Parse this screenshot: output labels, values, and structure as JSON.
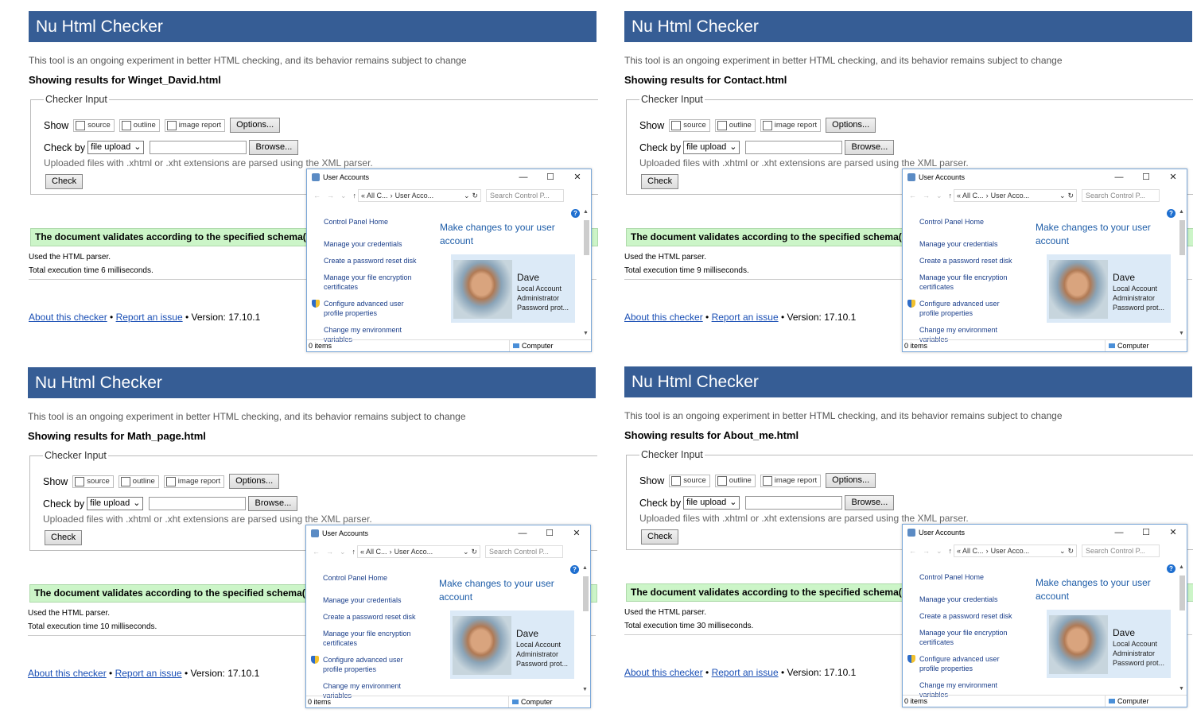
{
  "common": {
    "header_title": "Nu Html Checker",
    "tagline": "This tool is an ongoing experiment in better HTML checking, and its behavior remains subject to change",
    "showing_prefix": "Showing results for ",
    "checker_input_legend": "Checker Input",
    "show_label": "Show",
    "cb_source": "source",
    "cb_outline": "outline",
    "cb_image_report": "image report",
    "options_button": "Options...",
    "check_by_label": "Check by",
    "check_by_value": "file upload",
    "browse_button": "Browse...",
    "upload_note": "Uploaded files with .xhtml or .xht extensions are parsed using the XML parser.",
    "check_button": "Check",
    "valid_message": "The document validates according to the specified schema(s).",
    "used_parser": "Used the HTML parser.",
    "about_link": "About this checker",
    "bullet": " • ",
    "report_link": "Report an issue",
    "version": "Version: 17.10.1"
  },
  "panels": [
    {
      "file": "Winget_David.html",
      "exec": "Total execution time 6 milliseconds."
    },
    {
      "file": "Contact.html",
      "exec": "Total execution time 9 milliseconds."
    },
    {
      "file": "Math_page.html",
      "exec": "Total execution time 10 milliseconds."
    },
    {
      "file": "About_me.html",
      "exec": "Total execution time 30 milliseconds."
    }
  ],
  "window": {
    "title": "User Accounts",
    "minimize": "—",
    "maximize": "☐",
    "close": "✕",
    "nav_arrows": "←→⌄",
    "up_arrow": "↑",
    "breadcrumb_1": "« All C...",
    "breadcrumb_sep": "›",
    "breadcrumb_2": "User Acco...",
    "dropdown_chevron": "⌄",
    "refresh": "↻",
    "search_placeholder": "Search Control P...",
    "left_nav": [
      "Control Panel Home",
      "Manage your credentials",
      "Create a password reset disk",
      "Manage your file encryption certificates",
      "Configure advanced user profile properties",
      "Change my environment variables"
    ],
    "heading": "Make changes to your user account",
    "user_name": "Dave",
    "user_type": "Local Account",
    "user_role": "Administrator",
    "user_extra": "Password prot...",
    "help": "?",
    "scroll_up": "▲",
    "scroll_down": "▼",
    "status_items": "0 items",
    "status_location": "Computer"
  }
}
